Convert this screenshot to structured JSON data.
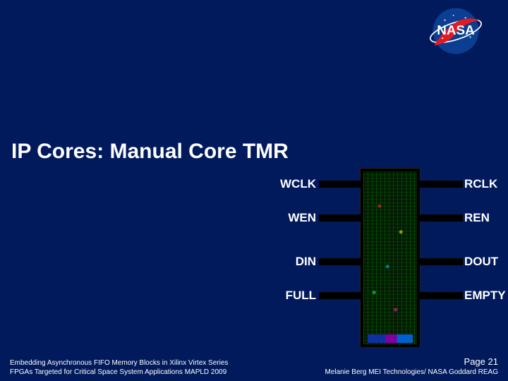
{
  "logo": {
    "text": "NASA",
    "alt": "nasa-meatball-logo"
  },
  "title": "IP Cores: Manual Core TMR",
  "pins": {
    "left": [
      "WCLK",
      "WEN",
      "DIN",
      "FULL"
    ],
    "right": [
      "RCLK",
      "REN",
      "DOUT",
      "EMPTY"
    ]
  },
  "footer": {
    "left_line1": "Embedding Asynchronous FIFO Memory Blocks in Xilinx Virtex Series",
    "left_line2": "FPGAs Targeted for Critical Space System Applications MAPLD 2009",
    "page_label": "Page",
    "page_number": "21",
    "right_line": "Melanie Berg MEI Technologies/ NASA Goddard REAG"
  }
}
